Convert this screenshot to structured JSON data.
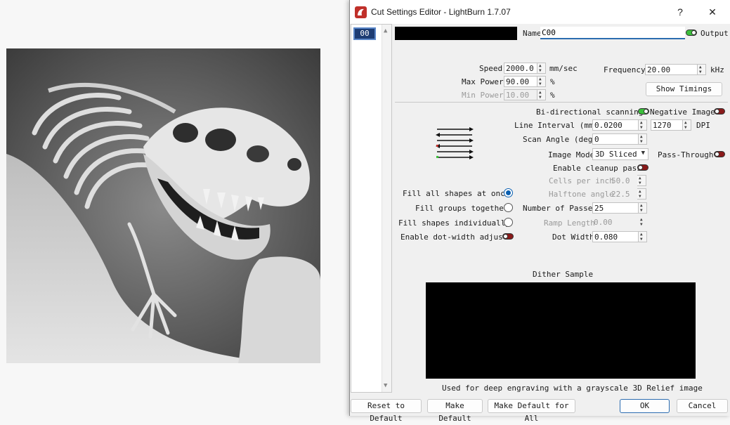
{
  "window": {
    "title": "Cut Settings Editor - LightBurn 1.7.07",
    "help_label": "?",
    "close_label": "✕"
  },
  "layer_list": {
    "selected_layer": "00"
  },
  "name_row": {
    "name_label": "Name",
    "name_value": "C00",
    "output_label": "Output",
    "output_on": true
  },
  "speed": {
    "label": "Speed",
    "value": "2000.0",
    "unit": "mm/sec"
  },
  "max_power": {
    "label": "Max Power",
    "value": "90.00",
    "unit": "%"
  },
  "min_power": {
    "label": "Min Power",
    "value": "10.00",
    "unit": "%"
  },
  "frequency": {
    "label": "Frequency",
    "value": "20.00",
    "unit": "kHz"
  },
  "show_timings_label": "Show Timings",
  "bidirectional": {
    "label": "Bi-directional scanning",
    "on": true
  },
  "negative_image": {
    "label": "Negative Image",
    "on": false
  },
  "line_interval": {
    "label": "Line Interval (mm)",
    "value": "0.0200",
    "dpi_value": "1270",
    "dpi_label": "DPI"
  },
  "scan_angle": {
    "label": "Scan Angle (deg)",
    "value": "0"
  },
  "image_mode": {
    "label": "Image Mode",
    "value": "3D Sliced"
  },
  "pass_through": {
    "label": "Pass-Through",
    "on": false
  },
  "cleanup_pass": {
    "label": "Enable cleanup pass",
    "on": false
  },
  "cells_per_inch": {
    "label": "Cells per inch",
    "value": "50.0"
  },
  "halftone_angle": {
    "label": "Halftone angle",
    "value": "22.5"
  },
  "number_of_passes": {
    "label": "Number of Passes",
    "value": "25"
  },
  "ramp_length": {
    "label": "Ramp Length",
    "value": "0.00"
  },
  "dot_width": {
    "label": "Dot Width",
    "value": "0.080"
  },
  "fill_options": [
    {
      "label": "Fill all shapes at once",
      "checked": true
    },
    {
      "label": "Fill groups together",
      "checked": false
    },
    {
      "label": "Fill shapes individually",
      "checked": false
    }
  ],
  "dot_width_adjust": {
    "label": "Enable dot-width adjust",
    "on": false
  },
  "dither": {
    "label": "Dither Sample",
    "description": "Used for deep engraving with a grayscale 3D Relief image"
  },
  "footer": {
    "reset_label": "Reset to Default",
    "make_default_label": "Make Default",
    "make_default_all_label": "Make Default for All",
    "ok_label": "OK",
    "cancel_label": "Cancel"
  },
  "colors": {
    "accent": "#2b6cb0",
    "toggle_on": "#3bbf3b",
    "toggle_off": "#8a1a1a",
    "selected_layer_bg": "#1d3c73"
  }
}
